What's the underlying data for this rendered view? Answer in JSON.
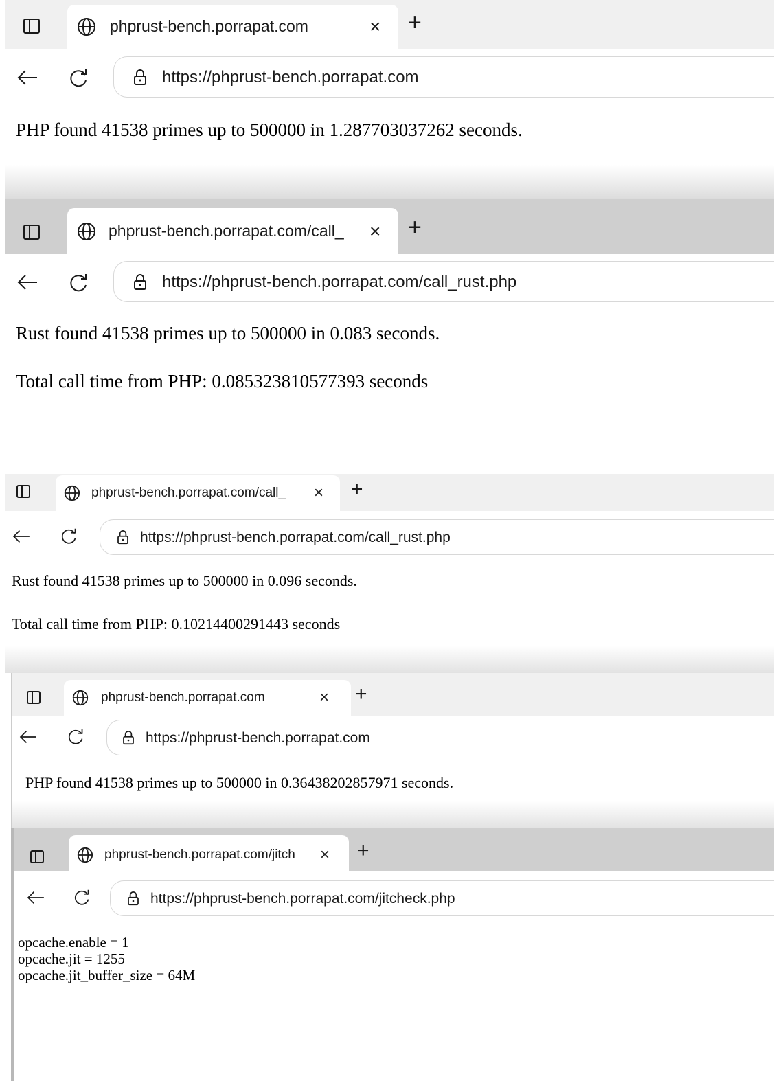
{
  "windows": [
    {
      "tab_title": "phprust-bench.porrapat.com",
      "close": "×",
      "new_tab": "+",
      "url": "https://phprust-bench.porrapat.com",
      "lines": [
        "PHP found 41538 primes up to 500000 in 1.287703037262 seconds."
      ]
    },
    {
      "tab_title": "phprust-bench.porrapat.com/call_",
      "close": "×",
      "new_tab": "+",
      "url": "https://phprust-bench.porrapat.com/call_rust.php",
      "lines": [
        "Rust found 41538 primes up to 500000 in 0.083 seconds.",
        "Total call time from PHP: 0.085323810577393 seconds"
      ]
    },
    {
      "tab_title": "phprust-bench.porrapat.com/call_",
      "close": "×",
      "new_tab": "+",
      "url": "https://phprust-bench.porrapat.com/call_rust.php",
      "lines": [
        "Rust found 41538 primes up to 500000 in 0.096 seconds.",
        "Total call time from PHP: 0.10214400291443 seconds"
      ]
    },
    {
      "tab_title": "phprust-bench.porrapat.com",
      "close": "×",
      "new_tab": "+",
      "url": "https://phprust-bench.porrapat.com",
      "lines": [
        "PHP found 41538 primes up to 500000 in 0.36438202857971 seconds."
      ]
    },
    {
      "tab_title": "phprust-bench.porrapat.com/jitch",
      "close": "×",
      "new_tab": "+",
      "url": "https://phprust-bench.porrapat.com/jitcheck.php",
      "lines": [
        "opcache.enable = 1",
        "opcache.jit = 1255",
        "opcache.jit_buffer_size = 64M"
      ]
    }
  ],
  "colors": {
    "tabstrip_light": "#f0f0f0",
    "tabstrip_dark": "#cfcfcf",
    "text": "#1a1a1a"
  },
  "icons": {
    "back": "arrow-left-icon",
    "reload": "reload-icon",
    "lock": "lock-icon",
    "globe": "globe-icon",
    "sidebar": "sidebar-icon"
  }
}
